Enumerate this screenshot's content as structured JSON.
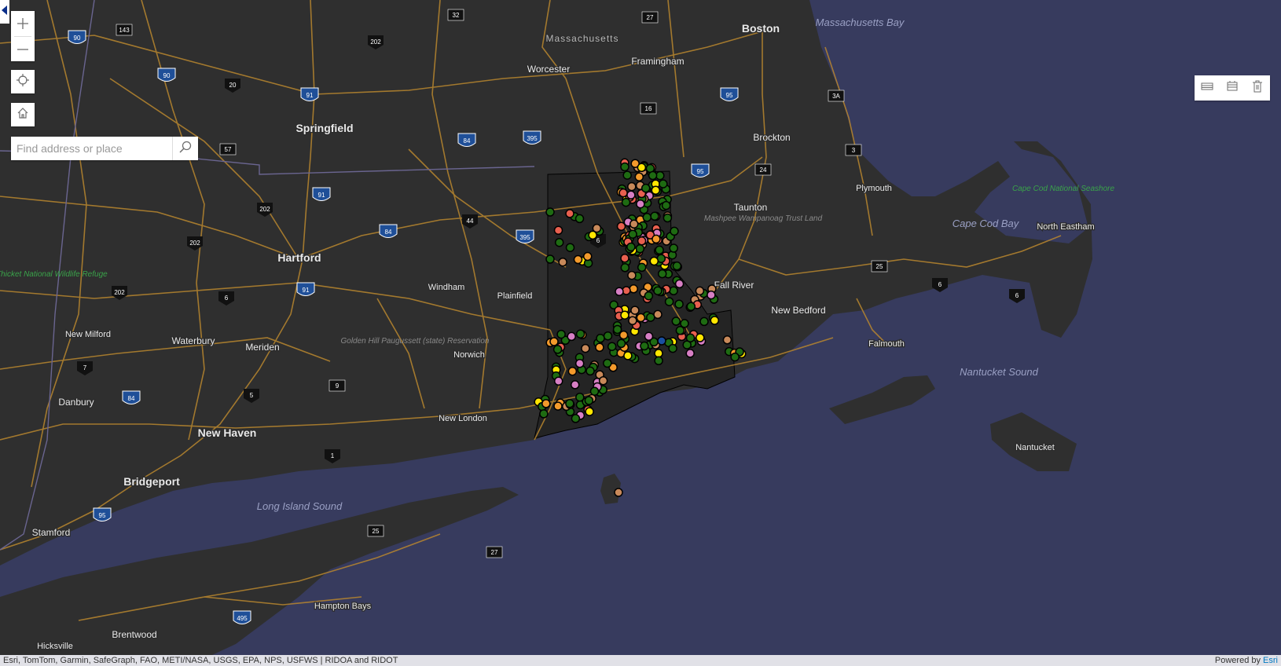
{
  "search": {
    "placeholder": "Find address or place"
  },
  "attribution": {
    "text": "Esri, TomTom, Garmin, SafeGraph, FAO, METI/NASA, USGS, EPA, NPS, USFWS | RIDOA and RIDOT",
    "powered_prefix": "Powered by ",
    "powered_link": "Esri"
  },
  "icons": {
    "zoom_in": "plus-icon",
    "zoom_out": "minus-icon",
    "locate": "locate-icon",
    "home": "home-icon",
    "search": "search-icon",
    "collapse": "chevron-left-icon",
    "tool1": "table-icon",
    "tool2": "layers-icon",
    "tool3": "trash-icon"
  },
  "colors": {
    "water": "#373b5e",
    "land": "#2f2f2f",
    "road": "#b8862e",
    "dot_green": "#1e6b12",
    "dot_red": "#e8604f",
    "dot_orange": "#f39a2c",
    "dot_pink": "#d77fc4",
    "dot_brown": "#c8895a",
    "dot_yellow": "#ffe600",
    "dot_blue": "#1a4fa0"
  },
  "labels": {
    "cities": [
      "Boston",
      "Springfield",
      "Hartford",
      "New Haven",
      "Bridgeport",
      "Worcester",
      "Framingham",
      "Brockton",
      "Taunton",
      "Fall River",
      "New Bedford",
      "Plymouth",
      "Waterbury",
      "Meriden",
      "New Milford",
      "Danbury",
      "Stamford",
      "Windham",
      "Plainfield",
      "Norwich",
      "New London",
      "Falmouth",
      "North Eastham",
      "Nantucket",
      "Hampton Bays",
      "Brentwood",
      "Hicksville",
      "Massachusetts"
    ],
    "water": [
      "Massachusetts Bay",
      "Cape Cod Bay",
      "Nantucket Sound",
      "Long Island Sound"
    ],
    "parks": [
      "Great Thicket National Wildlife Refuge",
      "Golden Hill Paugussett (state) Reservation",
      "Mashpee Wampanoag Trust Land",
      "Cape Cod National Seashore"
    ],
    "shields": [
      "90",
      "90",
      "91",
      "91",
      "91",
      "84",
      "84",
      "84",
      "395",
      "395",
      "95",
      "95",
      "95",
      "495",
      "202",
      "202",
      "202",
      "202",
      "20",
      "143",
      "32",
      "27",
      "16",
      "3A",
      "3",
      "24",
      "25",
      "57",
      "44",
      "6",
      "6",
      "6",
      "6",
      "7",
      "5",
      "1",
      "9",
      "25",
      "27"
    ]
  }
}
